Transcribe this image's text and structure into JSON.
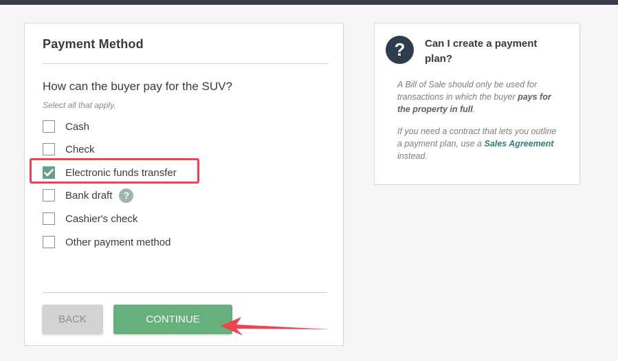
{
  "payment": {
    "title": "Payment Method",
    "question": "How can the buyer pay for the SUV?",
    "hint": "Select all that apply.",
    "options": [
      {
        "label": "Cash",
        "checked": false
      },
      {
        "label": "Check",
        "checked": false
      },
      {
        "label": "Electronic funds transfer",
        "checked": true
      },
      {
        "label": "Bank draft",
        "checked": false
      },
      {
        "label": "Cashier's check",
        "checked": false
      },
      {
        "label": "Other payment method",
        "checked": false
      }
    ],
    "help_icon": "?",
    "back_label": "BACK",
    "continue_label": "CONTINUE"
  },
  "help": {
    "icon": "?",
    "title": "Can I create a payment plan?",
    "p1_start": "A Bill of Sale should only be used for transactions in which the buyer ",
    "p1_bold": "pays for the property in full",
    "p1_end": ".",
    "p2_start": "If you need a contract that lets you outline a payment plan, use a ",
    "p2_link": "Sales Agreement",
    "p2_end": " instead."
  },
  "colors": {
    "accent_green": "#65b07b",
    "checkbox_checked": "#6a9e8c",
    "highlight_red": "#f0434f",
    "link_teal": "#2a8278",
    "topbar": "#3a3d47"
  },
  "icons": {
    "question_circle": "question-circle-icon",
    "checkmark": "checkmark-icon",
    "annotation_arrow": "red-arrow-annotation"
  }
}
